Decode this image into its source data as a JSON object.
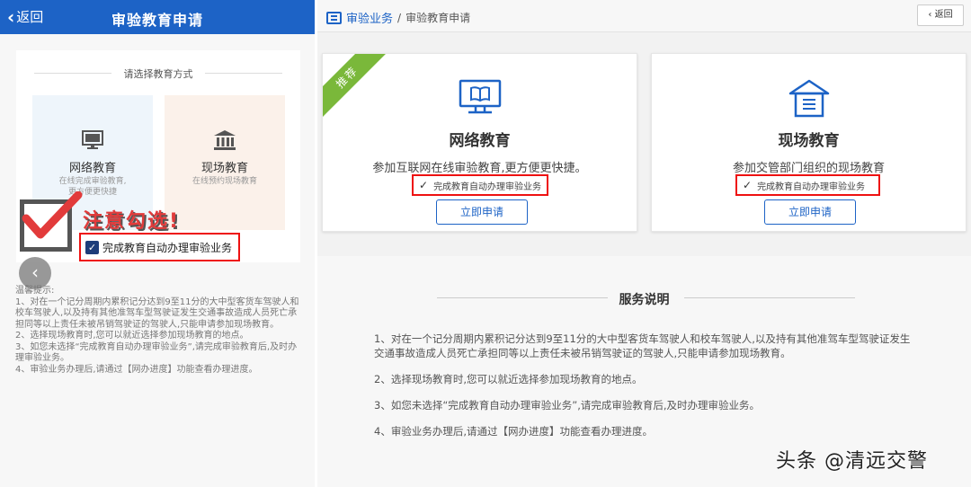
{
  "mobile": {
    "back_label": "返回",
    "title": "审验教育申请",
    "choose_label": "请选择教育方式",
    "options": [
      {
        "name": "网络教育",
        "desc1": "在线完成审验教育,",
        "desc2": "更方便更快捷"
      },
      {
        "name": "现场教育",
        "desc1": "在线预约现场教育",
        "desc2": ""
      }
    ],
    "warning": "注意勾选!",
    "auto_check_label": "完成教育自动办理审验业务",
    "tips": [
      "温馨提示:",
      "1、对在一个记分周期内累积记分达到9至11分的大中型客货车驾驶人和校车驾驶人,以及持有其他准驾车型驾驶证发生交通事故造成人员死亡承担同等以上责任未被吊销驾驶证的驾驶人,只能申请参加现场教育。",
      "2、选择现场教育时,您可以就近选择参加现场教育的地点。",
      "3、如您未选择“完成教育自动办理审验业务”,请完成审验教育后,及时办理审验业务。",
      "4、审验业务办理后,请通过【网办进度】功能查看办理进度。"
    ]
  },
  "desktop": {
    "breadcrumb": {
      "section": "审验业务",
      "separator": "/",
      "current": "审验教育申请"
    },
    "back_button": "返回",
    "cards": [
      {
        "ribbon": "推荐",
        "name": "网络教育",
        "desc": "参加互联网在线审验教育,更方便更快捷。",
        "check_label": "完成教育自动办理审验业务",
        "apply_label": "立即申请"
      },
      {
        "name": "现场教育",
        "desc": "参加交管部门组织的现场教育",
        "check_label": "完成教育自动办理审验业务",
        "apply_label": "立即申请"
      }
    ],
    "service": {
      "title": "服务说明",
      "items": [
        "1、对在一个记分周期内累积记分达到9至11分的大中型客货车驾驶人和校车驾驶人,以及持有其他准驾车型驾驶证发生交通事故造成人员死亡承担同等以上责任未被吊销驾驶证的驾驶人,只能申请参加现场教育。",
        "2、选择现场教育时,您可以就近选择参加现场教育的地点。",
        "3、如您未选择“完成教育自动办理审验业务”,请完成审验教育后,及时办理审验业务。",
        "4、审验业务办理后,请通过【网办进度】功能查看办理进度。"
      ]
    }
  },
  "watermark": "头条 @清远交警",
  "colors": {
    "brand_blue": "#1d63c6",
    "highlight_red": "#e11111",
    "ribbon_green": "#7ab83a"
  }
}
